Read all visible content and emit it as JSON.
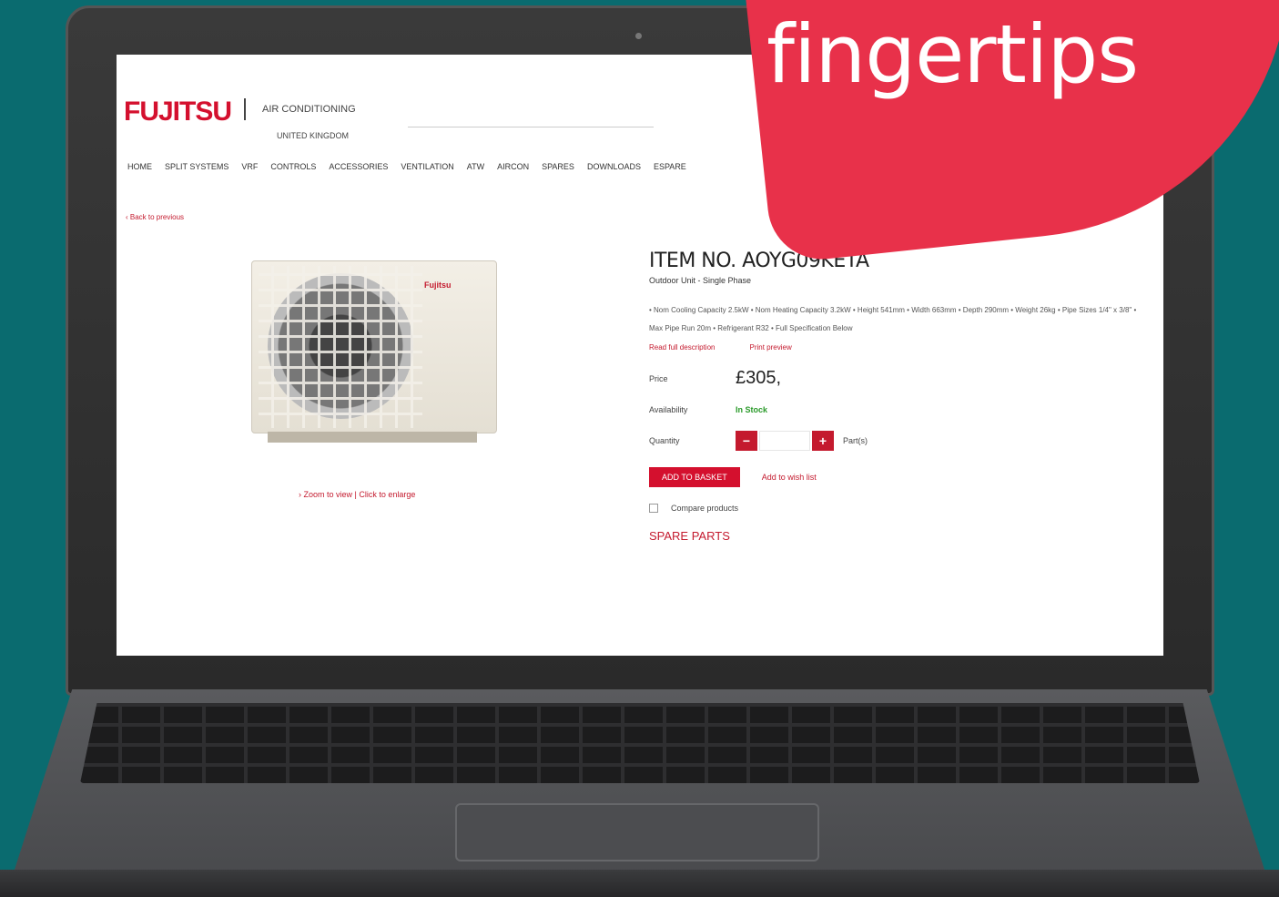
{
  "overlay": {
    "headline": "fingertips"
  },
  "site": {
    "logo": "FUJITSU",
    "logo_sub": "AIR CONDITIONING",
    "logo_region": "UNITED KINGDOM",
    "search_placeholder": "",
    "nav": [
      "HOME",
      "SPLIT SYSTEMS",
      "VRF",
      "CONTROLS",
      "ACCESSORIES",
      "VENTILATION",
      "ATW",
      "AIRCON",
      "SPARES",
      "DOWNLOADS",
      "ESPARE"
    ],
    "back_link": "‹ Back to previous"
  },
  "product": {
    "item_no": "ITEM NO. AOYG09KETA",
    "subtitle": "Outdoor Unit - Single Phase",
    "description": "• Nom Cooling Capacity 2.5kW • Nom Heating Capacity 3.2kW • Height 541mm • Width 663mm • Depth 290mm • Weight 26kg • Pipe Sizes 1/4\" x 3/8\" • Max Pipe Run 20m • Refrigerant R32 • Full Specification Below",
    "read_more": "Read full description",
    "print_preview": "Print preview",
    "price_label": "Price",
    "price": "£305,",
    "price_note": "",
    "availability_label": "Availability",
    "availability": "In Stock",
    "quantity_label": "Quantity",
    "quantity_value": "",
    "quantity_unit": "Part(s)",
    "add_to_basket": "ADD TO BASKET",
    "add_to_wishlist": "Add to wish list",
    "compare": "Compare products",
    "spare_parts": "SPARE PARTS",
    "image_brand": "Fujitsu",
    "image_links": "› Zoom to view | Click to enlarge"
  }
}
